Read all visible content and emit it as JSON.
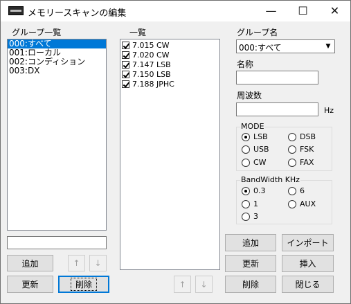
{
  "window": {
    "title": "メモリースキャンの編集",
    "minimize": "—",
    "maximize": "☐",
    "close": "✕"
  },
  "groups": {
    "label": "グループ一覧",
    "items": [
      "000:すべて",
      "001:ローカル",
      "002:コンディション",
      "003:DX"
    ],
    "selected_index": 0,
    "input_value": "",
    "add_label": "追加",
    "up_label": "↑",
    "down_label": "↓",
    "update_label": "更新",
    "delete_label": "削除"
  },
  "list": {
    "label": "一覧",
    "items": [
      {
        "text": "7.015 CW",
        "checked": true
      },
      {
        "text": "7.020 CW",
        "checked": true
      },
      {
        "text": "7.147 LSB",
        "checked": true
      },
      {
        "text": "7.150 LSB",
        "checked": true
      },
      {
        "text": "7.188 JPHC",
        "checked": true
      }
    ],
    "up_label": "↑",
    "down_label": "↓"
  },
  "detail": {
    "group_name_label": "グループ名",
    "group_name_value": "000:すべて",
    "name_label": "名称",
    "name_value": "",
    "freq_label": "周波数",
    "freq_value": "",
    "freq_unit": "Hz",
    "mode": {
      "title": "MODE",
      "options": [
        "LSB",
        "DSB",
        "USB",
        "FSK",
        "CW",
        "FAX"
      ],
      "selected": "LSB"
    },
    "bandwidth": {
      "title": "BandWidth KHz",
      "options": [
        "0.3",
        "6",
        "1",
        "AUX",
        "3"
      ],
      "selected": "0.3"
    }
  },
  "actions": {
    "add_label": "追加",
    "import_label": "インポート",
    "update_label": "更新",
    "insert_label": "挿入",
    "delete_label": "削除",
    "close_label": "閉じる"
  }
}
